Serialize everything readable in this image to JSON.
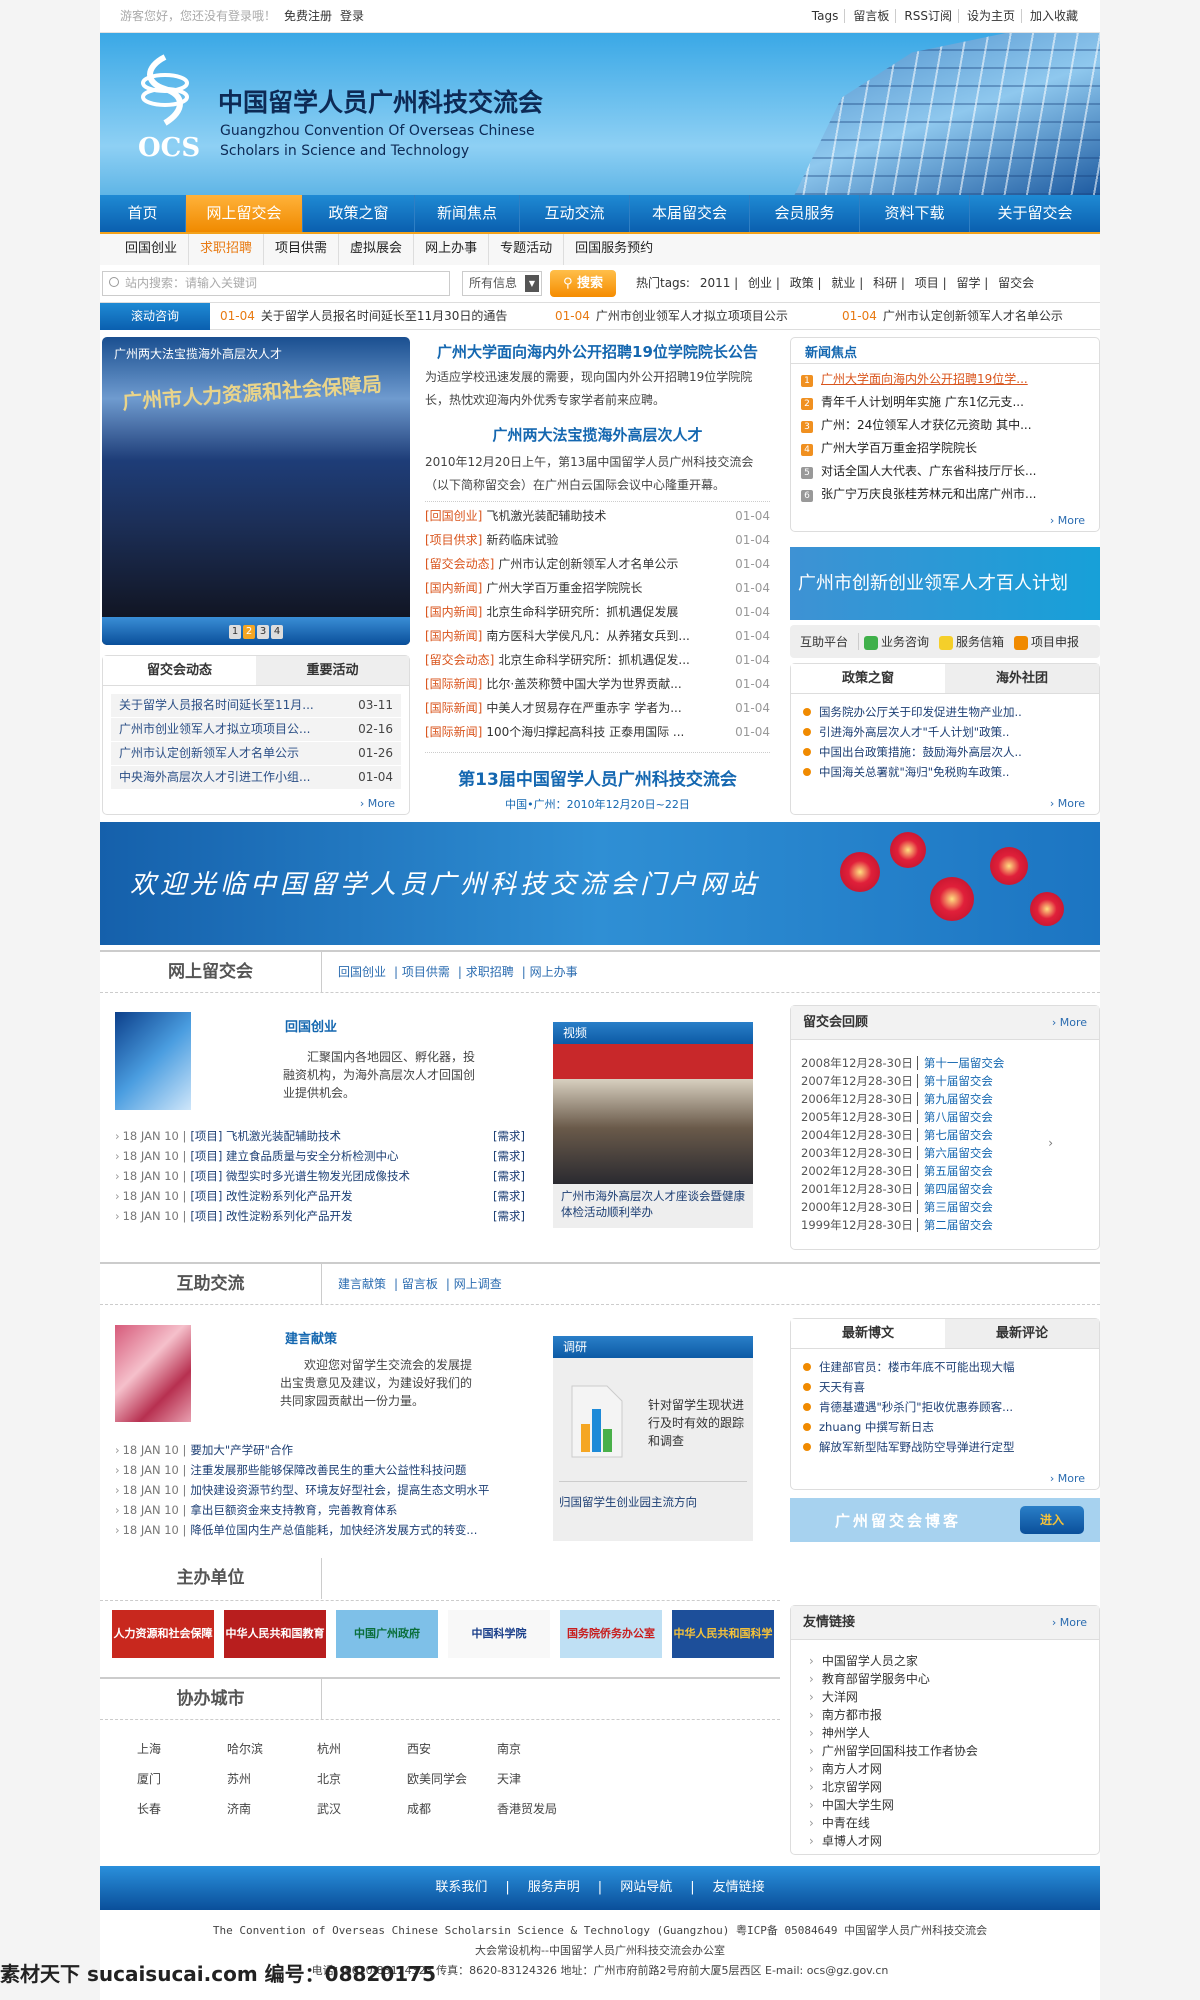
{
  "topbar": {
    "greeting": "游客您好，您还没有登录哦！",
    "register": "免费注册",
    "login": "登录",
    "right_links": [
      "Tags",
      "留言板",
      "RSS订阅",
      "设为主页",
      "加入收藏"
    ]
  },
  "header": {
    "logo_text": "OCS",
    "title_cn": "中国留学人员广州科技交流会",
    "title_en_1": "Guangzhou Convention Of Overseas Chinese",
    "title_en_2": "Scholars in Science and Technology"
  },
  "nav": {
    "items": [
      "首页",
      "网上留交会",
      "政策之窗",
      "新闻焦点",
      "互动交流",
      "本届留交会",
      "会员服务",
      "资料下载",
      "关于留交会"
    ],
    "active": "网上留交会"
  },
  "subnav": {
    "items": [
      "回国创业",
      "求职招聘",
      "项目供需",
      "虚拟展会",
      "网上办事",
      "专题活动",
      "回国服务预约"
    ],
    "active": "求职招聘"
  },
  "search": {
    "placeholder": "站内搜索：请输入关键词",
    "select_value": "所有信息",
    "button": "搜索",
    "tags_label": "热门tags:",
    "tags": [
      "2011",
      "创业",
      "政策",
      "就业",
      "科研",
      "项目",
      "留学",
      "留交会"
    ]
  },
  "ticker": {
    "label": "滚动咨询",
    "items": [
      {
        "date": "01-04",
        "text": "关于留学人员报名时间延长至11月30日的通告"
      },
      {
        "date": "01-04",
        "text": "广州市创业领军人才拟立项项目公示"
      },
      {
        "date": "01-04",
        "text": "广州市认定创新领军人才名单公示"
      }
    ]
  },
  "slideshow": {
    "caption": "广州两大法宝揽海外高层次人才",
    "sign": "广州市人力资源和社会保障局",
    "pages": [
      "1",
      "2",
      "3",
      "4"
    ],
    "active_page": "2"
  },
  "dynamics": {
    "tabs": [
      "留交会动态",
      "重要活动"
    ],
    "items": [
      {
        "t": "关于留学人员报名时间延长至11月...",
        "d": "03-11"
      },
      {
        "t": "广州市创业领军人才拟立项项目公...",
        "d": "02-16"
      },
      {
        "t": "广州市认定创新领军人才名单公示",
        "d": "01-26"
      },
      {
        "t": "中央海外高层次人才引进工作小组...",
        "d": "01-04"
      }
    ],
    "more": "› More"
  },
  "middle": {
    "headline1": "广州大学面向海内外公开招聘19位学院院长公告",
    "summary1": "为适应学校迅速发展的需要，现向国内外公开招聘19位学院院长，热忱欢迎海内外优秀专家学者前来应聘。",
    "headline2": "广州两大法宝揽海外高层次人才",
    "summary2": "2010年12月20日上午，第13届中国留学人员广州科技交流会（以下简称留交会）在广州白云国际会议中心隆重开幕。",
    "news": [
      {
        "c": "[回国创业]",
        "t": "飞机激光装配辅助技术",
        "d": "01-04"
      },
      {
        "c": "[项目供求]",
        "t": "新药临床试验",
        "d": "01-04"
      },
      {
        "c": "[留交会动态]",
        "t": "广州市认定创新领军人才名单公示",
        "d": "01-04"
      },
      {
        "c": "[国内新闻]",
        "t": "广州大学百万重金招学院院长",
        "d": "01-04"
      },
      {
        "c": "[国内新闻]",
        "t": "北京生命科学研究所：抓机遇促发展",
        "d": "01-04"
      },
      {
        "c": "[国内新闻]",
        "t": "南方医科大学侯凡凡：从养猪女兵到...",
        "d": "01-04"
      },
      {
        "c": "[留交会动态]",
        "t": "北京生命科学研究所：抓机遇促发...",
        "d": "01-04"
      },
      {
        "c": "[国际新闻]",
        "t": "比尔·盖茨称赞中国大学为世界贡献...",
        "d": "01-04"
      },
      {
        "c": "[国际新闻]",
        "t": "中美人才贸易存在严重赤字 学者为...",
        "d": "01-04"
      },
      {
        "c": "[国际新闻]",
        "t": "100个海归撑起高科技 正泰用国际 ...",
        "d": "01-04"
      }
    ],
    "event_title": "第13届中国留学人员广州科技交流会",
    "event_sub": "中国•广州：2010年12月20日~22日"
  },
  "focus": {
    "title": "新闻焦点",
    "items": [
      "广州大学面向海内外公开招聘19位学...",
      "青年千人计划明年实施 广东1亿元支...",
      "广州：24位领军人才获亿元资助 其中...",
      "广州大学百万重金招学院院长",
      "对话全国人大代表、广东省科技厅厅长...",
      "张广宁万庆良张桂芳林元和出席广州市..."
    ],
    "nums": [
      "1",
      "2",
      "3",
      "4",
      "5",
      "6"
    ],
    "more": "› More"
  },
  "promo": {
    "text": "广州市创新创业领军人才百人计划"
  },
  "help": {
    "label": "互助平台",
    "items": [
      "业务咨询",
      "服务信箱",
      "项目申报"
    ]
  },
  "policy": {
    "tabs": [
      "政策之窗",
      "海外社团"
    ],
    "items": [
      "国务院办公厅关于印发促进生物产业加..",
      "引进海外高层次人才\"千人计划\"政策..",
      "中国出台政策措施：鼓励海外高层次人..",
      "中国海关总署就\"海归\"免税购车政策.."
    ],
    "more": "› More"
  },
  "welcome": {
    "text": "欢迎光临中国留学人员广州科技交流会门户网站"
  },
  "online": {
    "title": "网上留交会",
    "links": [
      "回国创业",
      "项目供需",
      "求职招聘",
      "网上办事"
    ],
    "sub_title": "回国创业",
    "desc": "汇聚国内各地园区、孵化器，投融资机构，为海外高层次人才回国创业提供机会。",
    "list": [
      {
        "d": "18 JAN 10 |",
        "t": "[项目] 飞机激光装配辅助技术",
        "tag": "[需求]"
      },
      {
        "d": "18 JAN 10 |",
        "t": "[项目] 建立食品质量与安全分析检测中心",
        "tag": "[需求]"
      },
      {
        "d": "18 JAN 10 |",
        "t": "[项目] 微型实时多光谱生物发光团成像技术",
        "tag": "[需求]"
      },
      {
        "d": "18 JAN 10 |",
        "t": "[项目] 改性淀粉系列化产品开发",
        "tag": "[需求]"
      },
      {
        "d": "18 JAN 10 |",
        "t": "[项目] 改性淀粉系列化产品开发",
        "tag": "[需求]"
      }
    ],
    "video_label": "视频",
    "video_caption": "广州市海外高层次人才座谈会暨健康体检活动顺利举办"
  },
  "review": {
    "title": "留交会回顾",
    "more": "› More",
    "items": [
      {
        "d": "2008年12月28-30日",
        "n": "第十一届留交会"
      },
      {
        "d": "2007年12月28-30日",
        "n": "第十届留交会"
      },
      {
        "d": "2006年12月28-30日",
        "n": "第九届留交会"
      },
      {
        "d": "2005年12月28-30日",
        "n": "第八届留交会"
      },
      {
        "d": "2004年12月28-30日",
        "n": "第七届留交会"
      },
      {
        "d": "2003年12月28-30日",
        "n": "第六届留交会"
      },
      {
        "d": "2002年12月28-30日",
        "n": "第五届留交会"
      },
      {
        "d": "2001年12月28-30日",
        "n": "第四届留交会"
      },
      {
        "d": "2000年12月28-30日",
        "n": "第三届留交会"
      },
      {
        "d": "1999年12月28-30日",
        "n": "第二届留交会"
      }
    ]
  },
  "mutual": {
    "title": "互助交流",
    "links": [
      "建言献策",
      "留言板",
      "网上调查"
    ],
    "sub_title": "建言献策",
    "desc": "欢迎您对留学生交流会的发展提出宝贵意见及建议，为建设好我们的共同家园贡献出一份力量。",
    "list": [
      {
        "d": "18 JAN 10 |",
        "t": "要加大\"产学研\"合作"
      },
      {
        "d": "18 JAN 10 |",
        "t": "注重发展那些能够保障改善民生的重大公益性科技问题"
      },
      {
        "d": "18 JAN 10 |",
        "t": "加快建设资源节约型、环境友好型社会，提高生态文明水平"
      },
      {
        "d": "18 JAN 10 |",
        "t": "拿出巨额资金来支持教育，完善教育体系"
      },
      {
        "d": "18 JAN 10 |",
        "t": "降低单位国内生产总值能耗，加快经济发展方式的转变..."
      }
    ],
    "survey_label": "调研",
    "survey_text": "针对留学生现状进行及时有效的跟踪和调查",
    "survey_link": "归国留学生创业园主流方向"
  },
  "blog": {
    "tabs": [
      "最新博文",
      "最新评论"
    ],
    "items": [
      "住建部官员：楼市年底不可能出现大幅",
      "天天有喜",
      "肯德基遭遇\"秒杀门\"拒收优惠券顾客...",
      "zhuang 中撰写新日志",
      "解放军新型陆军野战防空导弹进行定型"
    ],
    "more": "› More",
    "banner": "广州留交会博客",
    "enter": "进入"
  },
  "hosts": {
    "title": "主办单位",
    "logos": [
      "人力资源和社会保障部",
      "中华人民共和国教育部",
      "中国广州政府",
      "中国科学院",
      "国务院侨务办公室",
      "中华人民共和国科学技术部"
    ]
  },
  "cities": {
    "title": "协办城市",
    "rows": [
      [
        "上海",
        "哈尔滨",
        "杭州",
        "西安",
        "南京"
      ],
      [
        "厦门",
        "苏州",
        "北京",
        "欧美同学会",
        "天津"
      ],
      [
        "长春",
        "济南",
        "武汉",
        "成都",
        "香港贸发局"
      ]
    ]
  },
  "links": {
    "title": "友情链接",
    "more": "› More",
    "items": [
      "中国留学人员之家",
      "教育部留学服务中心",
      "大洋网",
      "南方都市报",
      "神州学人",
      "广州留学回国科技工作者协会",
      "南方人才网",
      "北京留学网",
      "中国大学生网",
      "中青在线",
      "卓博人才网"
    ]
  },
  "footer": {
    "links": [
      "联系我们",
      "服务声明",
      "网站导航",
      "友情链接"
    ],
    "line1": "The Convention of Overseas Chinese Scholarsin Science & Technology (Guangzhou) 粤ICP备 05084649 中国留学人员广州科技交流会",
    "line2": "大会常设机构--中国留学人员广州科技交流会办公室",
    "line3": "电话：8620-83124323 传真：8620-83124326 地址：广州市府前路2号府前大厦5层西区 E-mail: ocs@gz.gov.cn"
  },
  "watermark": "素材天下 sucaisucai.com 编号：08820175",
  "colors": {
    "nav_blue": "#0a5faf",
    "accent_orange": "#f08a00",
    "link_blue": "#1467b0"
  }
}
